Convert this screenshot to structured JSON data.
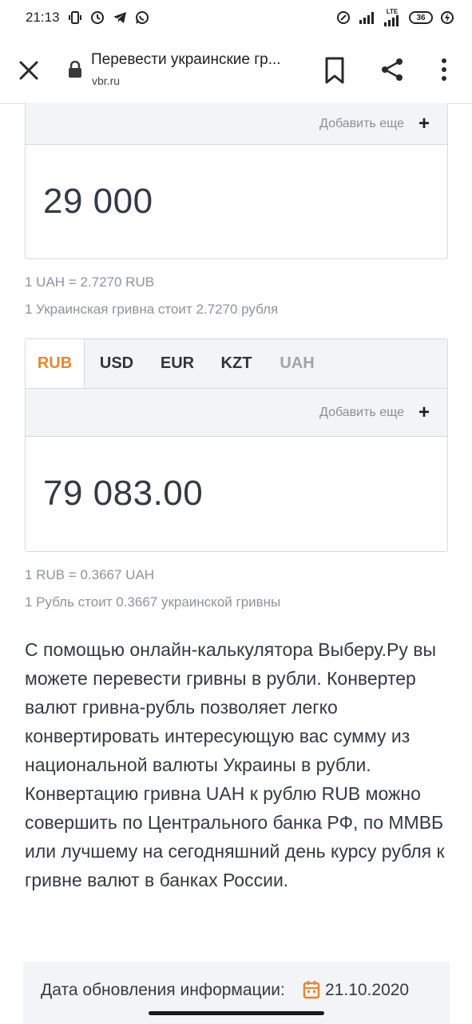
{
  "status": {
    "time": "21:13",
    "net_label": "LTE",
    "battery": "36"
  },
  "browser": {
    "title": "Перевести украинские гр...",
    "url": "vbr.ru"
  },
  "converter": {
    "source": {
      "add_more": "Добавить еще",
      "amount": "29 000",
      "rate_short": "1 UAH = 2.7270 RUB",
      "rate_long": "1 Украинская гривна стоит 2.7270 рубля"
    },
    "target": {
      "tabs": [
        "RUB",
        "USD",
        "EUR",
        "KZT",
        "UAH"
      ],
      "active_tab": "RUB",
      "add_more": "Добавить еще",
      "amount": "79 083.00",
      "rate_short": "1 RUB = 0.3667 UAH",
      "rate_long": "1 Рубль стоит 0.3667 украинской гривны"
    }
  },
  "article": {
    "text": "С помощью онлайн-калькулятора Выберу.Ру вы можете перевести гривны в рубли. Конвертер валют гривна-рубль позволяет легко конвертировать интересующую вас сумму из национальной валюты Украины в рубли. Конвертацию гривна UAH к рублю RUB можно совершить по Центрального банка РФ, по ММВБ или лучшему на сегодняшний день курсу рубля к гривне валют в банках России."
  },
  "update": {
    "label": "Дата обновления информации:",
    "date": "21.10.2020"
  },
  "colors": {
    "accent": "#e8872e",
    "text": "#333a45",
    "muted": "#8f9399"
  },
  "icons": [
    "close-icon",
    "lock-icon",
    "bookmark-icon",
    "share-icon",
    "more-icon",
    "plus-icon",
    "calendar-icon"
  ]
}
